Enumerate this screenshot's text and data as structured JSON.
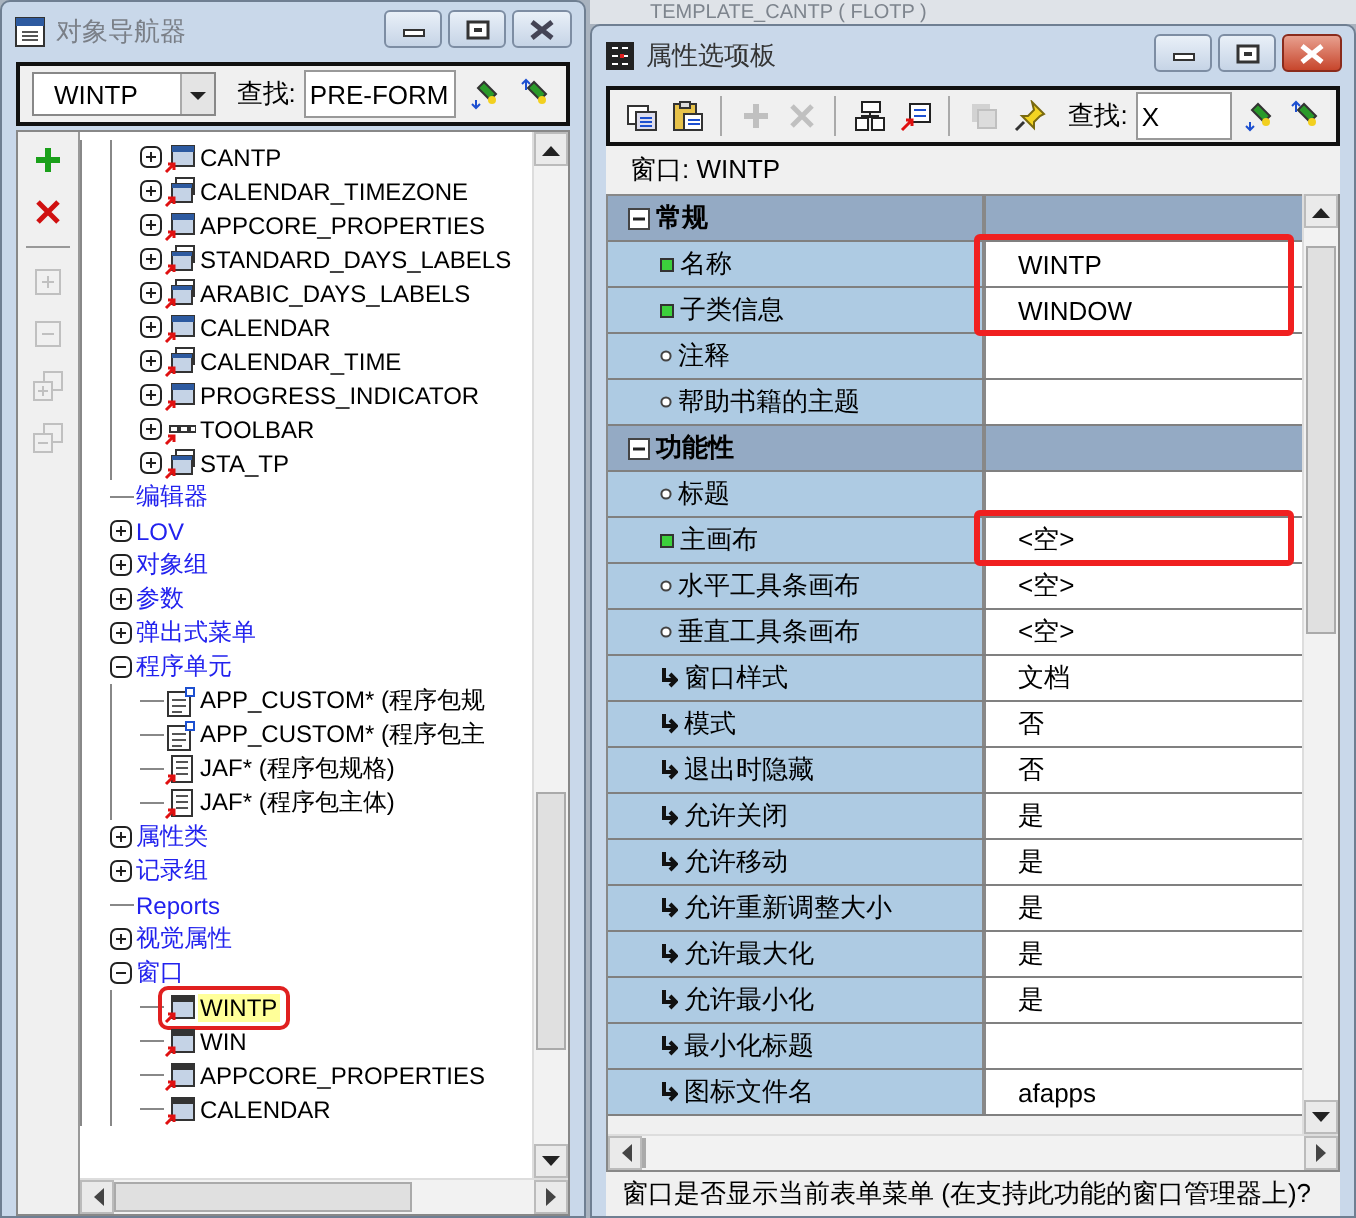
{
  "background_window": {
    "title": "TEMPLATE_CANTP ( FLOTP )"
  },
  "navigator": {
    "title": "对象导航器",
    "active": false,
    "toolbar": [
      {
        "kind": "dropdown",
        "value": "WINTP"
      },
      {
        "kind": "find",
        "label": "查找:",
        "value": "PRE-FORM"
      },
      {
        "kind": "search-next",
        "disabled": false
      },
      {
        "kind": "search-prev",
        "disabled": false
      }
    ],
    "side_tools": [
      {
        "kind": "add",
        "disabled": false
      },
      {
        "kind": "delete",
        "disabled": false
      },
      {
        "kind": "separator"
      },
      {
        "kind": "expand",
        "disabled": true
      },
      {
        "kind": "collapse",
        "disabled": true
      },
      {
        "kind": "expand-all",
        "disabled": true
      },
      {
        "kind": "collapse-all",
        "disabled": true
      }
    ],
    "tree": {
      "continued_children": [
        {
          "label": "CANTP",
          "kind": "canvas",
          "expanded": false,
          "selected": false
        },
        {
          "label": "CALENDAR_TIMEZONE",
          "kind": "canvas-stack",
          "expanded": false,
          "selected": false
        },
        {
          "label": "APPCORE_PROPERTIES",
          "kind": "canvas",
          "expanded": false,
          "selected": false
        },
        {
          "label": "STANDARD_DAYS_LABELS",
          "kind": "canvas-stack",
          "expanded": false,
          "selected": false
        },
        {
          "label": "ARABIC_DAYS_LABELS",
          "kind": "canvas-stack",
          "expanded": false,
          "selected": false
        },
        {
          "label": "CALENDAR",
          "kind": "canvas",
          "expanded": false,
          "selected": false
        },
        {
          "label": "CALENDAR_TIME",
          "kind": "canvas-stack",
          "expanded": false,
          "selected": false
        },
        {
          "label": "PROGRESS_INDICATOR",
          "kind": "canvas",
          "expanded": false,
          "selected": false
        },
        {
          "label": "TOOLBAR",
          "kind": "toolbar",
          "expanded": false,
          "selected": false
        },
        {
          "label": "STA_TP",
          "kind": "canvas-stack",
          "expanded": false,
          "selected": false
        }
      ],
      "items": [
        {
          "label": "编辑器",
          "kind": "category",
          "selected": false
        },
        {
          "label": "LOV",
          "kind": "category",
          "expanded": false,
          "selected": false
        },
        {
          "label": "对象组",
          "kind": "category",
          "expanded": false,
          "selected": false
        },
        {
          "label": "参数",
          "kind": "category",
          "expanded": false,
          "selected": false
        },
        {
          "label": "弹出式菜单",
          "kind": "category",
          "expanded": false,
          "selected": false
        },
        {
          "label": "程序单元",
          "kind": "category",
          "expanded": true,
          "selected": false,
          "children": [
            {
              "label": "APP_CUSTOM* (程序包规",
              "kind": "spec",
              "selected": false
            },
            {
              "label": "APP_CUSTOM* (程序包主",
              "kind": "spec",
              "selected": false
            },
            {
              "label": "JAF* (程序包规格)",
              "kind": "body",
              "selected": false
            },
            {
              "label": "JAF* (程序包主体)",
              "kind": "body",
              "selected": false
            }
          ]
        },
        {
          "label": "属性类",
          "kind": "category",
          "expanded": false,
          "selected": false
        },
        {
          "label": "记录组",
          "kind": "category",
          "expanded": false,
          "selected": false
        },
        {
          "label": "Reports",
          "kind": "category",
          "selected": false
        },
        {
          "label": "视觉属性",
          "kind": "category",
          "expanded": false,
          "selected": false
        },
        {
          "label": "窗口",
          "kind": "category",
          "expanded": true,
          "selected": false,
          "children": [
            {
              "label": "WINTP",
              "kind": "window",
              "selected": true,
              "marked": true
            },
            {
              "label": "WIN",
              "kind": "window",
              "selected": false
            },
            {
              "label": "APPCORE_PROPERTIES",
              "kind": "window",
              "selected": false
            },
            {
              "label": "CALENDAR",
              "kind": "window",
              "selected": false
            }
          ]
        }
      ]
    }
  },
  "palette": {
    "title": "属性选项板",
    "active": true,
    "toolbar": [
      {
        "kind": "copy",
        "disabled": false
      },
      {
        "kind": "paste",
        "disabled": false
      },
      {
        "kind": "separator"
      },
      {
        "kind": "add",
        "disabled": true
      },
      {
        "kind": "delete",
        "disabled": true
      },
      {
        "kind": "separator"
      },
      {
        "kind": "property-class",
        "disabled": false
      },
      {
        "kind": "inherit",
        "disabled": false
      },
      {
        "kind": "separator"
      },
      {
        "kind": "intersect",
        "disabled": true
      },
      {
        "kind": "pin",
        "disabled": false
      },
      {
        "kind": "find",
        "label": "查找:",
        "value": "X"
      },
      {
        "kind": "search-next",
        "disabled": false
      },
      {
        "kind": "search-prev",
        "disabled": false
      }
    ],
    "context": "窗口: WINTP",
    "properties": [
      {
        "kind": "group",
        "label": "常规",
        "expanded": true
      },
      {
        "kind": "required",
        "label": "名称",
        "value": "WINTP",
        "marked": true
      },
      {
        "kind": "required",
        "label": "子类信息",
        "value": "WINDOW",
        "marked": true
      },
      {
        "kind": "optional",
        "label": "注释"
      },
      {
        "kind": "optional",
        "label": "帮助书籍的主题"
      },
      {
        "kind": "group",
        "label": "功能性",
        "expanded": true
      },
      {
        "kind": "optional",
        "label": "标题"
      },
      {
        "kind": "required",
        "label": "主画布",
        "value": "<空>",
        "marked": true
      },
      {
        "kind": "optional",
        "label": "水平工具条画布",
        "value": "<空>"
      },
      {
        "kind": "optional",
        "label": "垂直工具条画布",
        "value": "<空>"
      },
      {
        "kind": "inherited",
        "label": "窗口样式",
        "value": "文档"
      },
      {
        "kind": "inherited",
        "label": "模式",
        "value": "否"
      },
      {
        "kind": "inherited",
        "label": "退出时隐藏",
        "value": "否"
      },
      {
        "kind": "inherited",
        "label": "允许关闭",
        "value": "是"
      },
      {
        "kind": "inherited",
        "label": "允许移动",
        "value": "是"
      },
      {
        "kind": "inherited",
        "label": "允许重新调整大小",
        "value": "是"
      },
      {
        "kind": "inherited",
        "label": "允许最大化",
        "value": "是"
      },
      {
        "kind": "inherited",
        "label": "允许最小化",
        "value": "是"
      },
      {
        "kind": "inherited",
        "label": "最小化标题"
      },
      {
        "kind": "inherited",
        "label": "图标文件名",
        "value": "afapps"
      }
    ],
    "hint": "窗口是否显示当前表单菜单 (在支持此功能的窗口管理器上)?"
  }
}
